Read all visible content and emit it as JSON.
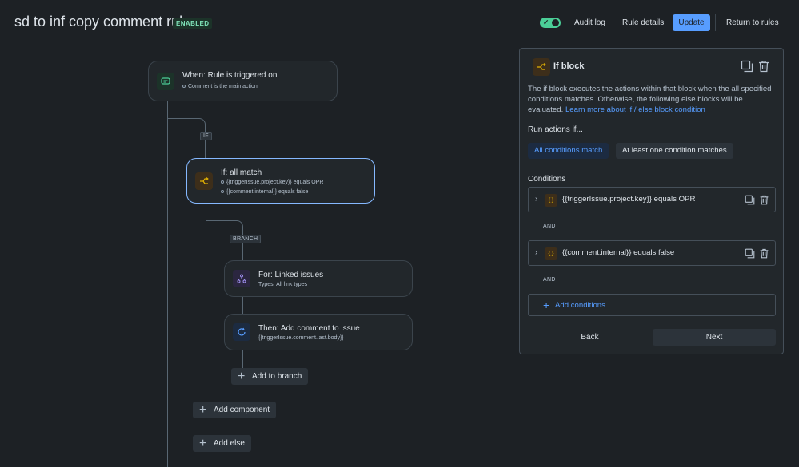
{
  "header": {
    "rule_title": "sd to inf copy comment rule",
    "status_badge": "ENABLED",
    "toggle_on": true,
    "audit_log": "Audit log",
    "rule_details": "Rule details",
    "update": "Update",
    "return_to_rules": "Return to rules"
  },
  "canvas": {
    "trigger": {
      "title": "When: Rule is triggered on",
      "sub": "Comment is the main action",
      "icon": "comment-icon"
    },
    "if_tag": "IF",
    "if_node": {
      "title": "If: all match",
      "cond1": "{{triggerIssue.project.key}} equals OPR",
      "cond2": "{{comment.internal}} equals false",
      "icon": "branch-icon"
    },
    "branch_tag": "BRANCH",
    "for_node": {
      "title": "For: Linked issues",
      "sub": "Types: All link types",
      "icon": "hierarchy-icon"
    },
    "then_node": {
      "title": "Then: Add comment to issue",
      "sub": "{{triggerIssue.comment.last.body}}",
      "icon": "refresh-icon"
    },
    "add_to_branch": "Add to branch",
    "add_component": "Add component",
    "add_else": "Add else"
  },
  "panel": {
    "title": "If block",
    "desc": "The if block executes the actions within that block when the all specified conditions matches. Otherwise, the following else blocks will be evaluated.",
    "link": "Learn more about if / else block condition",
    "run_label": "Run actions if...",
    "seg_all": "All conditions match",
    "seg_one": "At least one condition matches",
    "conditions_label": "Conditions",
    "conditions": [
      {
        "text": "{{triggerIssue.project.key}} equals OPR",
        "icon_text": "{}"
      },
      {
        "text": "{{comment.internal}} equals false",
        "icon_text": "{}"
      }
    ],
    "and_label": "AND",
    "add_conditions": "Add conditions...",
    "back": "Back",
    "next": "Next"
  },
  "colors": {
    "background": "#1d2125",
    "accent": "#579dff",
    "enabled_green": "#4bce97",
    "selected_border": "#85b8ff"
  }
}
